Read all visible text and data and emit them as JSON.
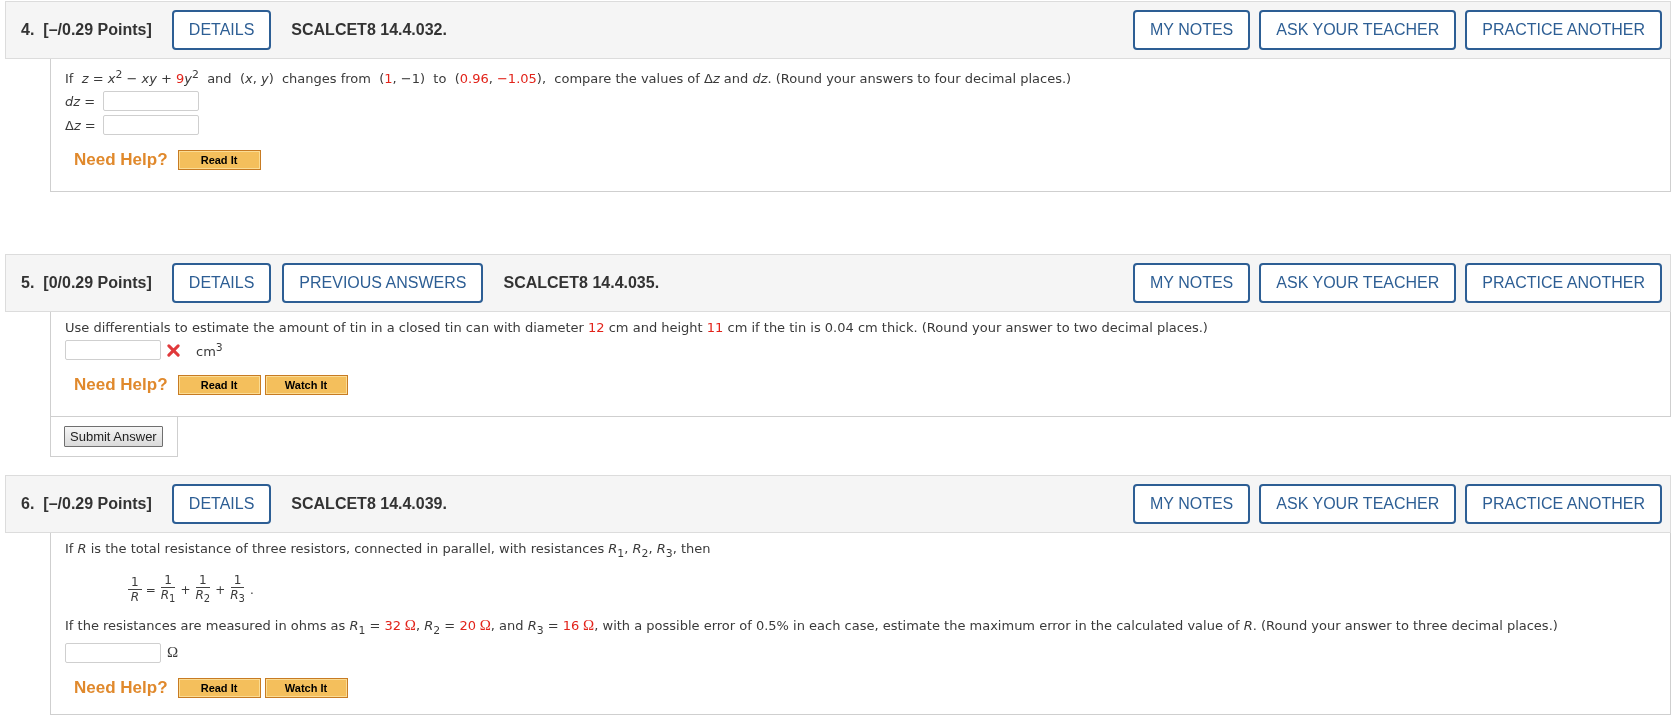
{
  "questions": [
    {
      "number": "4.",
      "points": "[–/0.29 Points]",
      "tabs": [
        "DETAILS"
      ],
      "code": "SCALCET8 14.4.032.",
      "actions": [
        "MY NOTES",
        "ASK YOUR TEACHER",
        "PRACTICE ANOTHER"
      ],
      "content": [
        {
          "kind": "paragraph",
          "segments": [
            {
              "kind": "text",
              "text": "If  *z* = *x*$^{2}$ − *xy* + "
            },
            {
              "kind": "value",
              "text": "9"
            },
            {
              "kind": "text",
              "text": "*y*$^{2}$  and  (*x*, *y*)  changes from  ("
            },
            {
              "kind": "value",
              "text": "1"
            },
            {
              "kind": "text",
              "text": ", −1)  to  ("
            },
            {
              "kind": "value",
              "text": "0.96"
            },
            {
              "kind": "text",
              "text": ", "
            },
            {
              "kind": "value",
              "text": "−1.05"
            },
            {
              "kind": "text",
              "text": "),  compare the values of Δ"
            },
            {
              "kind": "variable",
              "text": "z"
            },
            {
              "kind": "text",
              "text": " and *dz*. (Round your answers to four decimal places.)"
            }
          ]
        },
        {
          "kind": "answer",
          "label": [
            {
              "kind": "variable",
              "text": "dz"
            },
            {
              "kind": "text",
              "text": " ="
            }
          ]
        },
        {
          "kind": "answer",
          "label": [
            {
              "kind": "text",
              "text": "Δ"
            },
            {
              "kind": "variable",
              "text": "z"
            },
            {
              "kind": "text",
              "text": " ="
            }
          ]
        }
      ],
      "help": {
        "label": "Need Help?",
        "buttons": [
          "Read It"
        ]
      }
    },
    {
      "number": "5.",
      "points": "[0/0.29 Points]",
      "tabs": [
        "DETAILS",
        "PREVIOUS ANSWERS"
      ],
      "code": "SCALCET8 14.4.035.",
      "actions": [
        "MY NOTES",
        "ASK YOUR TEACHER",
        "PRACTICE ANOTHER"
      ],
      "content": [
        {
          "kind": "paragraph",
          "segments": [
            {
              "kind": "text",
              "text": "Use differentials to estimate the amount of tin in a closed tin can with diameter "
            },
            {
              "kind": "value",
              "text": "12"
            },
            {
              "kind": "text",
              "text": " cm and height "
            },
            {
              "kind": "value",
              "text": "11"
            },
            {
              "kind": "text",
              "text": " cm if the tin is 0.04 cm thick. (Round your answer to two decimal places.)"
            }
          ]
        },
        {
          "kind": "answer",
          "incorrect": true,
          "unit": "cm$^{3}$"
        }
      ],
      "help": {
        "label": "Need Help?",
        "buttons": [
          "Read It",
          "Watch It"
        ]
      },
      "submit": "Submit Answer"
    },
    {
      "number": "6.",
      "points": "[–/0.29 Points]",
      "tabs": [
        "DETAILS"
      ],
      "code": "SCALCET8 14.4.039.",
      "actions": [
        "MY NOTES",
        "ASK YOUR TEACHER",
        "PRACTICE ANOTHER"
      ],
      "content": [
        {
          "kind": "paragraph",
          "segments": [
            {
              "kind": "text",
              "text": "If *R* is the total resistance of three resistors, connected in parallel, with resistances *R*$_{1}$, *R*$_{2}$, *R*$_{3}$, then"
            }
          ]
        },
        {
          "kind": "formula",
          "terms": [
            {
              "kind": "fraction",
              "numerator": "1",
              "denominator": "*R*"
            },
            {
              "kind": "operator",
              "text": "="
            },
            {
              "kind": "fraction",
              "numerator": "1",
              "denominator": "*R*$_{1}$"
            },
            {
              "kind": "operator",
              "text": "+"
            },
            {
              "kind": "fraction",
              "numerator": "1",
              "denominator": "*R*$_{2}$"
            },
            {
              "kind": "operator",
              "text": "+"
            },
            {
              "kind": "fraction",
              "numerator": "1",
              "denominator": "*R*$_{3}$"
            },
            {
              "kind": "operator",
              "text": "."
            }
          ]
        },
        {
          "kind": "paragraph",
          "segments": [
            {
              "kind": "text",
              "text": "If the resistances are measured in ohms as *R*$_{1}$ = "
            },
            {
              "kind": "value",
              "text": "32"
            },
            {
              "kind": "unit",
              "text": " Ω"
            },
            {
              "kind": "text",
              "text": ", *R*$_{2}$ = "
            },
            {
              "kind": "value",
              "text": "20"
            },
            {
              "kind": "unit",
              "text": " Ω"
            },
            {
              "kind": "text",
              "text": ", and *R*$_{3}$ = "
            },
            {
              "kind": "value",
              "text": "16"
            },
            {
              "kind": "unit",
              "text": " Ω"
            },
            {
              "kind": "text",
              "text": ", with a possible error of 0.5% in each case, estimate the maximum error in the calculated value of *R*. (Round your answer to three decimal places.)"
            }
          ]
        },
        {
          "kind": "answer",
          "unit": "Ω"
        }
      ],
      "help": {
        "label": "Need Help?",
        "buttons": [
          "Read It",
          "Watch It"
        ]
      }
    }
  ]
}
